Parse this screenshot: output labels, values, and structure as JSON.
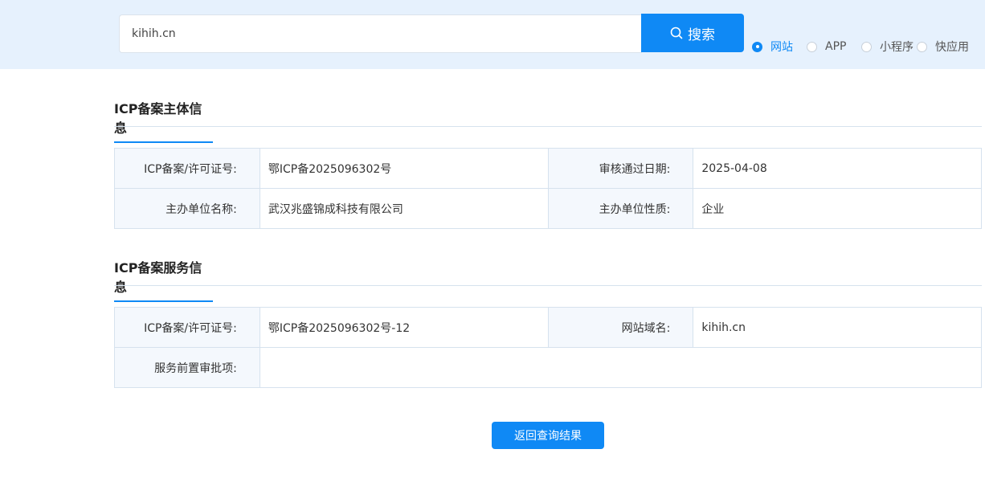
{
  "search": {
    "value": "kihih.cn",
    "button_label": "搜索",
    "types": [
      {
        "label": "网站",
        "checked": true
      },
      {
        "label": "APP",
        "checked": false
      },
      {
        "label": "小程序",
        "checked": false
      },
      {
        "label": "快应用",
        "checked": false
      }
    ]
  },
  "subject": {
    "title": "ICP备案主体信息",
    "license_label": "ICP备案/许可证号:",
    "license_value": "鄂ICP备2025096302号",
    "date_label": "审核通过日期:",
    "date_value": "2025-04-08",
    "org_label": "主办单位名称:",
    "org_value": "武汉兆盛锦成科技有限公司",
    "nature_label": "主办单位性质:",
    "nature_value": "企业"
  },
  "service": {
    "title": "ICP备案服务信息",
    "license_label": "ICP备案/许可证号:",
    "license_value": "鄂ICP备2025096302号-12",
    "domain_label": "网站域名:",
    "domain_value": "kihih.cn",
    "approval_label": "服务前置审批项:",
    "approval_value": ""
  },
  "back_button": "返回查询结果",
  "colors": {
    "accent": "#0f89f5",
    "topbar": "#e6f1fd"
  }
}
